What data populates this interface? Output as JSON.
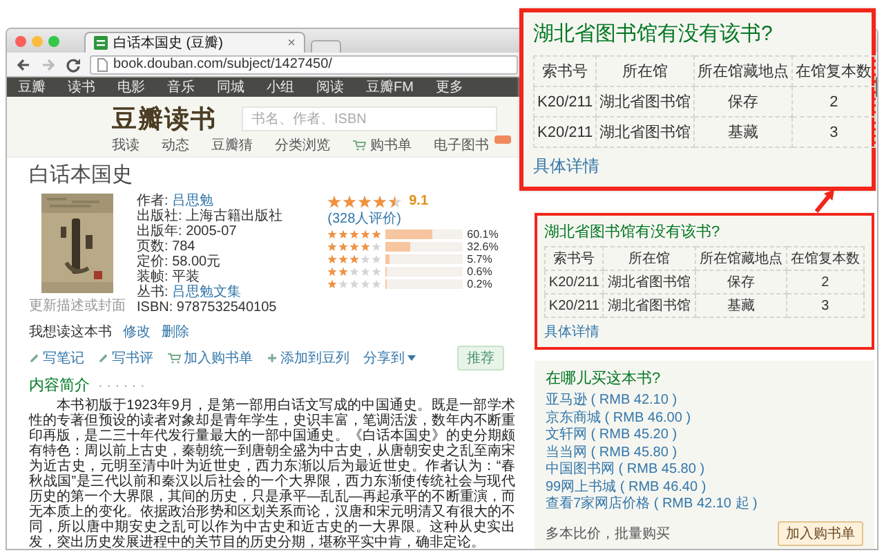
{
  "browser": {
    "tab_title": "白话本国史 (豆瓣)",
    "tab_close": "×",
    "url": "book.douban.com/subject/1427450/",
    "nav": [
      "豆瓣",
      "读书",
      "电影",
      "音乐",
      "同城",
      "小组",
      "阅读",
      "豆瓣FM",
      "更多"
    ]
  },
  "site": {
    "logo": "豆瓣读书",
    "search": {
      "placeholder": "书名、作者、ISBN"
    },
    "subnav": [
      {
        "label": "我读",
        "kind": "link"
      },
      {
        "label": "动态",
        "kind": "link"
      },
      {
        "label": "豆瓣猜",
        "kind": "link"
      },
      {
        "label": "分类浏览",
        "kind": "link"
      },
      {
        "label": "购书单",
        "kind": "cart"
      },
      {
        "label": "电子图书",
        "kind": "new"
      }
    ]
  },
  "book": {
    "title": "白话本国史",
    "cover_caption": "更新描述或封面",
    "info": [
      {
        "label": "作者:",
        "value": "吕思勉",
        "kind": "link"
      },
      {
        "label": "出版社:",
        "value": "上海古籍出版社",
        "kind": "text"
      },
      {
        "label": "出版年:",
        "value": "2005-07",
        "kind": "text"
      },
      {
        "label": "页数:",
        "value": "784",
        "kind": "text"
      },
      {
        "label": "定价:",
        "value": "58.00元",
        "kind": "text"
      },
      {
        "label": "装帧:",
        "value": "平装",
        "kind": "text"
      },
      {
        "label": "丛书:",
        "value": "吕思勉文集",
        "kind": "link"
      },
      {
        "label": "ISBN:",
        "value": "9787532540105",
        "kind": "text"
      }
    ],
    "rating": {
      "stars": 4.5,
      "score": "9.1",
      "count": "(328人评价)",
      "bars": [
        {
          "stars": 5,
          "level": 0.601,
          "percent": "60.1%"
        },
        {
          "stars": 4,
          "level": 0.326,
          "percent": "32.6%"
        },
        {
          "stars": 3,
          "level": 0.057,
          "percent": "5.7%"
        },
        {
          "stars": 2,
          "level": 0.006,
          "percent": "0.6%"
        },
        {
          "stars": 1,
          "level": 0.002,
          "percent": "0.2%"
        }
      ]
    },
    "status": {
      "label": "我想读这本书",
      "links": [
        "修改",
        "删除"
      ]
    },
    "actions": [
      {
        "label": "写笔记",
        "kind": "pencil"
      },
      {
        "label": "写书评",
        "kind": "pencil"
      },
      {
        "label": "加入购书单",
        "kind": "cart"
      },
      {
        "label": "添加到豆列",
        "kind": "plus"
      },
      {
        "label": "分享到",
        "kind": "menu"
      }
    ],
    "recommend": "推荐",
    "intro": {
      "heading": "内容简介",
      "dots": "· · · · · ·",
      "text": "本书初版于1923年9月，是第一部用白话文写成的中国通史。既是一部学术性的专著但预设的读者对象却是青年学生，史识丰富，笔调活泼，数年内不断重印再版，是二三十年代发行量最大的一部中国通史。《白话本国史》的史分期颇有特色：周以前上古史，秦朝统一到唐朝全盛为中古史，从唐朝安史之乱至南宋为近古史，元明至清中叶为近世史，西力东渐以后为最近世史。作者认为：“春秋战国”是三代以前和秦汉以后社会的一个大界限，西力东渐使传统社会与现代历史的第一个大界限，其间的历史，只是承平—乱乱—再起承平的不断重演，而无本质上的变化。依据政治形势和区划关系而论，汉唐和宋元明清又有很大的不同，所以唐中期安史之乱可以作为中古史和近古史的一大界限。这种从史实出发，突出历史发展进程中的关节目的历史分期，堪称平实中肯，确非定论。"
    }
  },
  "library": {
    "title": "湖北省图书馆有没有该书?",
    "columns": [
      "索书号",
      "所在馆",
      "所在馆藏地点",
      "在馆复本数"
    ],
    "rows": [
      [
        "K20/211",
        "湖北省图书馆",
        "保存",
        "2"
      ],
      [
        "K20/211",
        "湖北省图书馆",
        "基藏",
        "3"
      ]
    ],
    "more": "具体详情"
  },
  "buy": {
    "title": "在哪儿买这本书?",
    "stores": [
      "亚马逊 ( RMB 42.10 )",
      "京东商城 ( RMB 46.00 )",
      "文轩网 ( RMB 45.20 )",
      "当当网 ( RMB 45.80 )",
      "中国图书网 ( RMB 45.80 )",
      "99网上书城 ( RMB 46.40 )",
      "查看7家网店价格 ( RMB 42.10 起 )"
    ],
    "compare": "多本比价，批量购买",
    "add_button": "加入购书单"
  },
  "callout": {
    "title": "湖北省图书馆有没有该书?",
    "columns": [
      "索书号",
      "所在馆",
      "所在馆藏地点",
      "在馆复本数"
    ],
    "rows": [
      [
        "K20/211",
        "湖北省图书馆",
        "保存",
        "2"
      ],
      [
        "K20/211",
        "湖北省图书馆",
        "基藏",
        "3"
      ]
    ],
    "more": "具体详情"
  }
}
